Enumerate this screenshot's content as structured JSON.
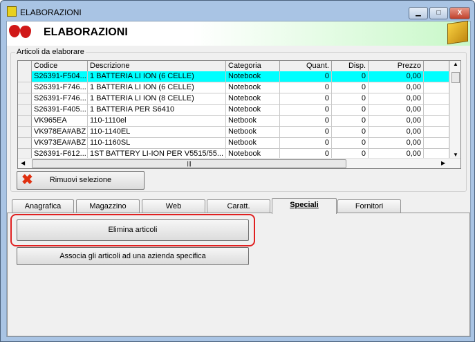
{
  "window": {
    "title": "ELABORAZIONI",
    "minimize": "▁",
    "maximize": "□",
    "close": "X"
  },
  "header": {
    "title": "ELABORAZIONI"
  },
  "group": {
    "label": "Articoli da elaborare"
  },
  "grid": {
    "columns": [
      "Codice",
      "Descrizione",
      "Categoria",
      "Quant.",
      "Disp.",
      "Prezzo"
    ],
    "rows": [
      [
        "S26391-F504...",
        "1  BATTERIA LI ION (6 CELLE)",
        "Notebook",
        "0",
        "0",
        "0,00"
      ],
      [
        "S26391-F746...",
        "1  BATTERIA LI ION (6 CELLE)",
        "Notebook",
        "0",
        "0",
        "0,00"
      ],
      [
        "S26391-F746...",
        "1  BATTERIA LI ION (8 CELLE)",
        "Notebook",
        "0",
        "0",
        "0,00"
      ],
      [
        "S26391-F405...",
        "1  BATTERIA PER S6410",
        "Notebook",
        "0",
        "0",
        "0,00"
      ],
      [
        "VK965EA",
        "110-1110el",
        "Netbook",
        "0",
        "0",
        "0,00"
      ],
      [
        "VK978EA#ABZ",
        "110-1140EL",
        "Netbook",
        "0",
        "0",
        "0,00"
      ],
      [
        "VK973EA#ABZ",
        "110-1160SL",
        "Netbook",
        "0",
        "0",
        "0,00"
      ],
      [
        "S26391-F612...",
        "1ST BATTERY LI-ION PER V5515/55...",
        "Notebook",
        "0",
        "0",
        "0,00"
      ]
    ],
    "selected_row": 0,
    "selection_color": "#00ffff"
  },
  "remove_button": "Rimuovi selezione",
  "tabs": [
    {
      "label": "Anagrafica"
    },
    {
      "label": "Magazzino"
    },
    {
      "label": "Web"
    },
    {
      "label": "Caratt."
    },
    {
      "label": "Speciali",
      "active": true
    },
    {
      "label": "Fornitori"
    }
  ],
  "panel": {
    "delete_button": "Elimina articoli",
    "associate_button": "Associa gli articoli ad una azienda specifica"
  },
  "highlight_color": "#e02020"
}
